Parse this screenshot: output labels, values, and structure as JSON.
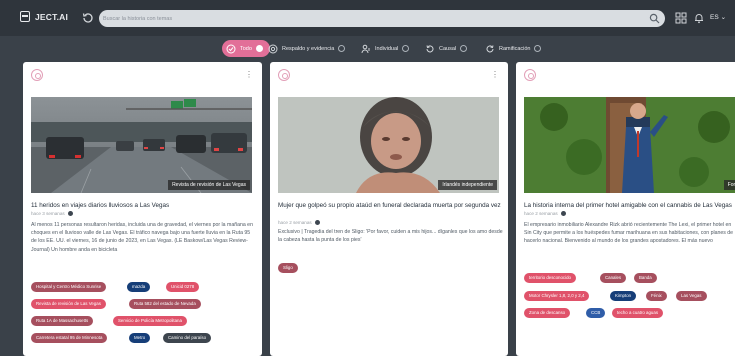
{
  "app": {
    "name": "JECT.AI"
  },
  "search": {
    "placeholder": "Buscar la historia con temas"
  },
  "header": {
    "language": "ES"
  },
  "filters": [
    {
      "label": "Todo",
      "active": true
    },
    {
      "label": "Respaldo y evidencia",
      "active": false
    },
    {
      "label": "Individual",
      "active": false
    },
    {
      "label": "Causal",
      "active": false
    },
    {
      "label": "Ramificación",
      "active": false
    }
  ],
  "cards": [
    {
      "image_label": "Revista de revisión de Las Vegas",
      "title": "11 heridos en viajes diarios lluviosos a Las Vegas",
      "time": "hace 3 semanas",
      "excerpt": "Al menos 11 personas resultaron heridas, incluida una de gravedad, el viernes por la mañana en choques en el lluvioso valle de Las Vegas. El tráfico navega bajo una fuerte lluvia en la Ruta 95 de los EE. UU. el viernes, 16 de junio de 2023, en Las Vegas. (LE Baskow/Las Vegas Review-Journal) Un hombre anda en bicicleta",
      "tags": [
        "Hospital y Centro Médico Sunrise",
        "mazda",
        "Unicid 0278",
        "Revista de revisión de Las Vegas",
        "Ruta 582 del estado de Nevada",
        "Ruta 1A de Massachusetts",
        "Servicio de Policía Metropolitana",
        "Carretera estatal 95 de Minnesota",
        "Metro",
        "Camino del paraíso"
      ]
    },
    {
      "image_label": "Irlandés independiente",
      "title": "Mujer que golpeó su propio ataúd en funeral declarada muerta por segunda vez",
      "time": "hace 2 semanas",
      "excerpt": "Exclusivo | Tragedia del tren de Sligo: 'Por favor, cuiden a mis hijos... díganles que los amo desde la cabeza hasta la punta de los pies'",
      "tags": [
        "Sligo"
      ]
    },
    {
      "image_label": "Forb",
      "title": "La historia interna del primer hotel amigable con el cannabis de Las Vegas",
      "time": "hace 2 semanas",
      "excerpt": "El empresario inmobiliario Alexandre Rizk abrió recientemente The Lexi, el primer hotel en Sin City que permite a los huéspedes fumar marihuana en sus habitaciones, con planes de hacerlo nacional. Bienvenido al mundo de los grandes apostadores. El más nuevo",
      "tags": [
        "territorio desconocido",
        "Canales",
        "Banda",
        "Motor Chrysler 1,8, 2,0 y 2,4",
        "Kimpton",
        "Fénix",
        "Las Vegas",
        "Zona de descanso",
        "CCB",
        "techo a cuatro aguas"
      ]
    }
  ]
}
